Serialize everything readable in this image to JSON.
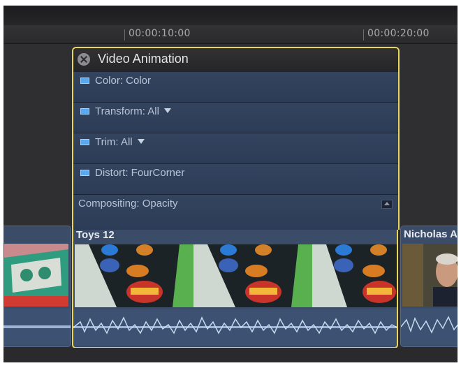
{
  "ruler": {
    "timecode_1": "00:00:10:00",
    "timecode_2": "00:00:20:00"
  },
  "animation_editor": {
    "title": "Video Animation",
    "lanes": [
      {
        "label": "Color: Color",
        "has_menu": false
      },
      {
        "label": "Transform: All",
        "has_menu": true
      },
      {
        "label": "Trim: All",
        "has_menu": true
      },
      {
        "label": "Distort: FourCorner",
        "has_menu": false
      },
      {
        "label": "Compositing: Opacity",
        "has_menu": false
      }
    ]
  },
  "clips": {
    "left": {
      "name": ""
    },
    "selected": {
      "name": "Toys 12"
    },
    "right": {
      "name": "Nicholas A"
    }
  },
  "colors": {
    "selection": "#e7d65a",
    "clip_blue": "#3b4c68",
    "keyframe_icon": "#5aa9ee"
  },
  "icons": {
    "close": "close-icon",
    "menu": "triangle-down-icon",
    "collapse": "collapse-icon",
    "keyframe": "animation-lane-icon"
  }
}
